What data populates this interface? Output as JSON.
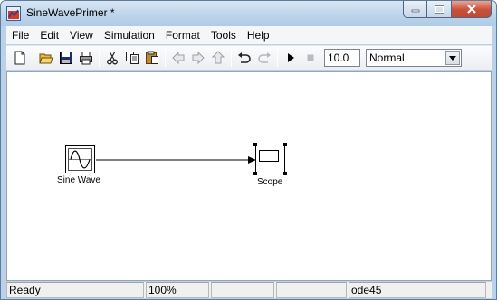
{
  "window": {
    "title": "SineWavePrimer *"
  },
  "menu": {
    "items": [
      "File",
      "Edit",
      "View",
      "Simulation",
      "Format",
      "Tools",
      "Help"
    ]
  },
  "toolbar": {
    "buttons": [
      "new-icon",
      "open-icon",
      "save-icon",
      "print-icon",
      "cut-icon",
      "copy-icon",
      "paste-icon",
      "back-icon",
      "forward-icon",
      "up-icon",
      "undo-icon",
      "redo-icon",
      "start-simulation-icon",
      "stop-simulation-icon"
    ],
    "stop_time": "10.0",
    "simulation_mode": "Normal"
  },
  "model": {
    "blocks": [
      {
        "name": "sine-wave",
        "label": "Sine Wave"
      },
      {
        "name": "scope",
        "label": "Scope"
      }
    ]
  },
  "status": {
    "state": "Ready",
    "zoom": "100%",
    "field3": "",
    "field4": "",
    "solver": "ode45"
  },
  "colors": {
    "titlebar": "#bcd3ea",
    "close_button": "#c8503a",
    "run_arrow": "#000000"
  }
}
